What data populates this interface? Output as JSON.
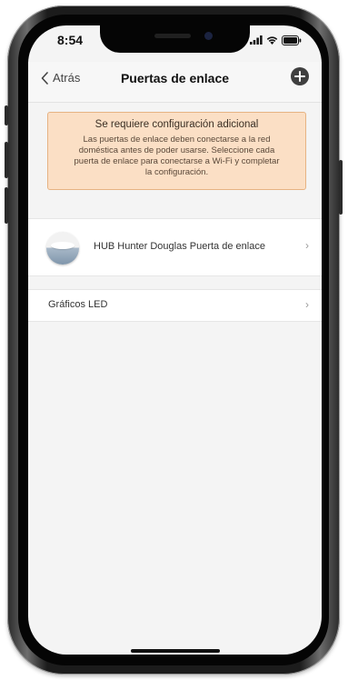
{
  "status_bar": {
    "time": "8:54"
  },
  "nav": {
    "back_label": "Atrás",
    "title": "Puertas de enlace"
  },
  "alert": {
    "title": "Se requiere configuración adicional",
    "lines": [
      "Las puertas de enlace deben conectarse a la red",
      "doméstica antes de poder usarse. Seleccione cada",
      "puerta de enlace para conectarse a Wi-Fi y completar",
      "la configuración."
    ]
  },
  "gateways": [
    {
      "label": "HUB Hunter Douglas Puerta de enlace",
      "chevron": "›"
    }
  ],
  "led": {
    "label": "Gráficos LED",
    "chevron": "›"
  },
  "icons": {
    "back": "chevron-left-icon",
    "add": "plus-circle-icon",
    "hub": "hub-device-icon",
    "signal": "signal-icon",
    "wifi": "wifi-icon",
    "battery": "battery-icon"
  },
  "colors": {
    "alert_bg": "#fbdfc5",
    "alert_border": "#e6b383",
    "add_button": "#3f3f3f"
  }
}
